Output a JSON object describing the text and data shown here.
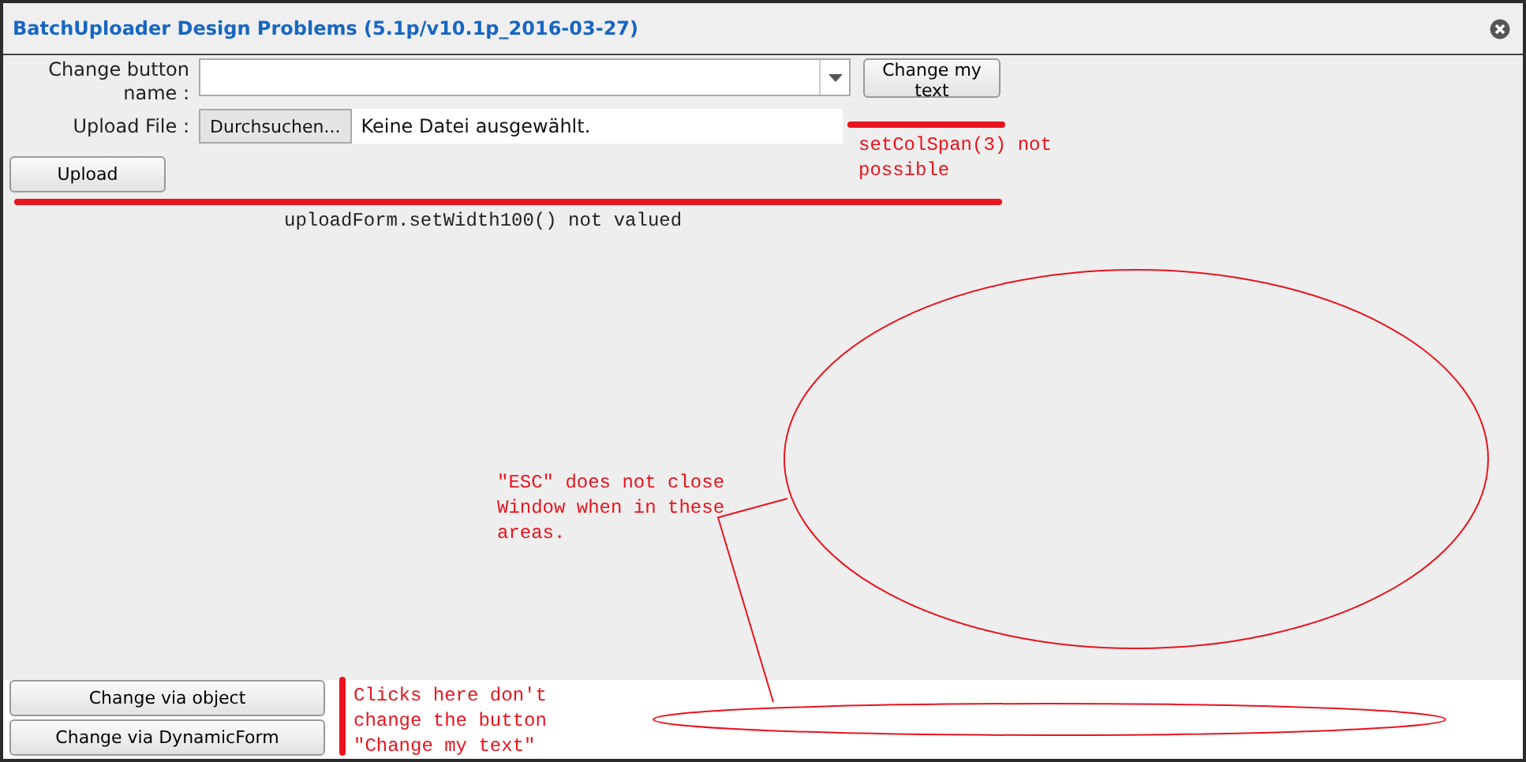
{
  "window": {
    "title": "BatchUploader Design Problems (5.1p/v10.1p_2016-03-27)"
  },
  "form": {
    "change_button_label": "Change button name :",
    "change_button": "Change my text",
    "upload_label": "Upload File :",
    "browse_button": "Durchsuchen...",
    "file_status": "Keine Datei ausgewählt.",
    "upload_button": "Upload"
  },
  "bottom_buttons": [
    "Change via object",
    "Change via DynamicForm"
  ],
  "notes": {
    "colspan": "setColSpan(3) not possible",
    "width": "uploadForm.setWidth100() not valued",
    "esc": "\"ESC\" does not close Window when in these areas.",
    "clicks": "Clicks here don't change the button \"Change my text\""
  }
}
